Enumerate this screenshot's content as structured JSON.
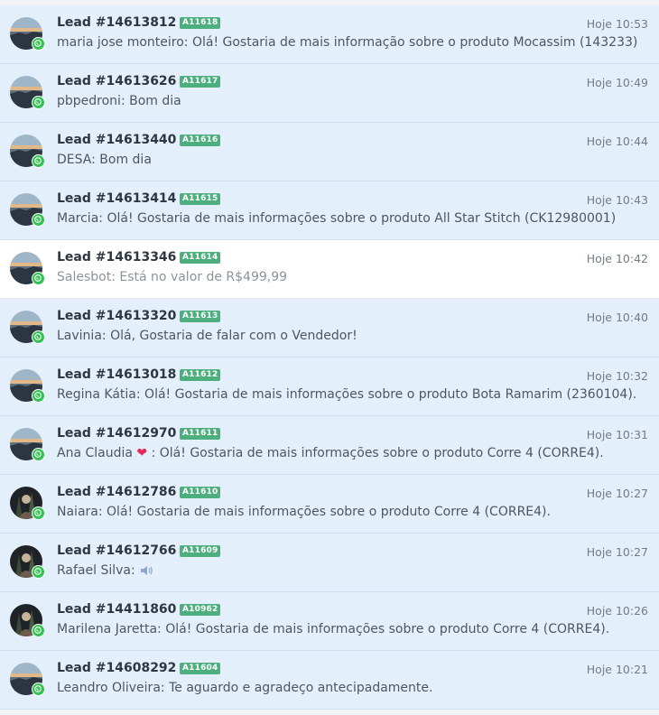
{
  "leads": [
    {
      "title": "Lead #14613812",
      "tag": "A11618",
      "time": "Hoje 10:53",
      "sender": "maria jose monteiro",
      "text": "Olá! Gostaria de mais informação sobre o produto Mocassim (143233)",
      "read": false,
      "avatar": "landscape-avatar"
    },
    {
      "title": "Lead #14613626",
      "tag": "A11617",
      "time": "Hoje 10:49",
      "sender": "pbpedroni",
      "text": "Bom dia",
      "read": false,
      "avatar": "landscape-avatar"
    },
    {
      "title": "Lead #14613440",
      "tag": "A11616",
      "time": "Hoje 10:44",
      "sender": "DESA",
      "text": "Bom dia",
      "read": false,
      "avatar": "landscape-avatar"
    },
    {
      "title": "Lead #14613414",
      "tag": "A11615",
      "time": "Hoje 10:43",
      "sender": "Marcia",
      "text": "Olá! Gostaria de mais informações sobre o produto All Star Stitch (CK12980001)",
      "read": false,
      "avatar": "landscape-avatar"
    },
    {
      "title": "Lead #14613346",
      "tag": "A11614",
      "time": "Hoje 10:42",
      "sender": "Salesbot",
      "text": "Está no valor de R$499,99",
      "read": true,
      "avatar": "landscape-avatar"
    },
    {
      "title": "Lead #14613320",
      "tag": "A11613",
      "time": "Hoje 10:40",
      "sender": "Lavinia",
      "text": "Olá, Gostaria de falar com o Vendedor!",
      "read": false,
      "avatar": "landscape-avatar"
    },
    {
      "title": "Lead #14613018",
      "tag": "A11612",
      "time": "Hoje 10:32",
      "sender": "Regina Kátia",
      "text": "Olá! Gostaria de mais informações sobre o produto Bota Ramarim (2360104).",
      "read": false,
      "avatar": "landscape-avatar"
    },
    {
      "title": "Lead #14612970",
      "tag": "A11611",
      "time": "Hoje 10:31",
      "sender": "Ana Claudia",
      "text": "Olá! Gostaria de mais informações sobre o produto Corre 4 (CORRE4).",
      "read": false,
      "avatar": "landscape-avatar",
      "emoji": "heart-icon"
    },
    {
      "title": "Lead #14612786",
      "tag": "A11610",
      "time": "Hoje 10:27",
      "sender": "Naiara",
      "text": "Olá! Gostaria de mais informações sobre o produto Corre 4 (CORRE4).",
      "read": false,
      "avatar": "dark-avatar"
    },
    {
      "title": "Lead #14612766",
      "tag": "A11609",
      "time": "Hoje 10:27",
      "sender": "Rafael Silva",
      "text": "",
      "read": false,
      "avatar": "dark-avatar",
      "emoji": "speaker-icon"
    },
    {
      "title": "Lead #14411860",
      "tag": "A10962",
      "time": "Hoje 10:26",
      "sender": "Marilena Jaretta",
      "text": "Olá! Gostaria de mais informações sobre o produto Corre 4 (CORRE4).",
      "read": false,
      "avatar": "dark-avatar"
    },
    {
      "title": "Lead #14608292",
      "tag": "A11604",
      "time": "Hoje 10:21",
      "sender": "Leandro Oliveira",
      "text": "Te aguardo e agradeço antecipadamente.",
      "read": false,
      "avatar": "landscape-avatar"
    }
  ],
  "colors": {
    "unread_bg": "#e3effa",
    "read_bg": "#ffffff",
    "tag_bg": "#4caf7d",
    "whatsapp": "#33c152"
  },
  "icons": {
    "channel": "whatsapp-icon"
  }
}
